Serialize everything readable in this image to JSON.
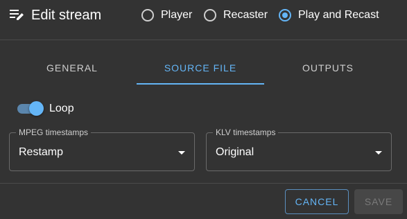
{
  "header": {
    "title": "Edit stream",
    "icon": "edit-list-icon",
    "mode_options": [
      {
        "label": "Player",
        "checked": false
      },
      {
        "label": "Recaster",
        "checked": false
      },
      {
        "label": "Play and Recast",
        "checked": true
      }
    ]
  },
  "tabs": [
    {
      "label": "GENERAL",
      "active": false
    },
    {
      "label": "SOURCE FILE",
      "active": true
    },
    {
      "label": "OUTPUTS",
      "active": false
    }
  ],
  "loop": {
    "label": "Loop",
    "on": true
  },
  "mpeg_timestamps": {
    "label": "MPEG timestamps",
    "value": "Restamp"
  },
  "klv_timestamps": {
    "label": "KLV timestamps",
    "value": "Original"
  },
  "actions": {
    "cancel_label": "CANCEL",
    "save_label": "SAVE",
    "save_disabled": true
  },
  "colors": {
    "background": "#333333",
    "accent": "#64b5f6",
    "text": "#ffffff",
    "muted_text": "#cfcfcf",
    "disabled_text": "#7a7a7a"
  }
}
